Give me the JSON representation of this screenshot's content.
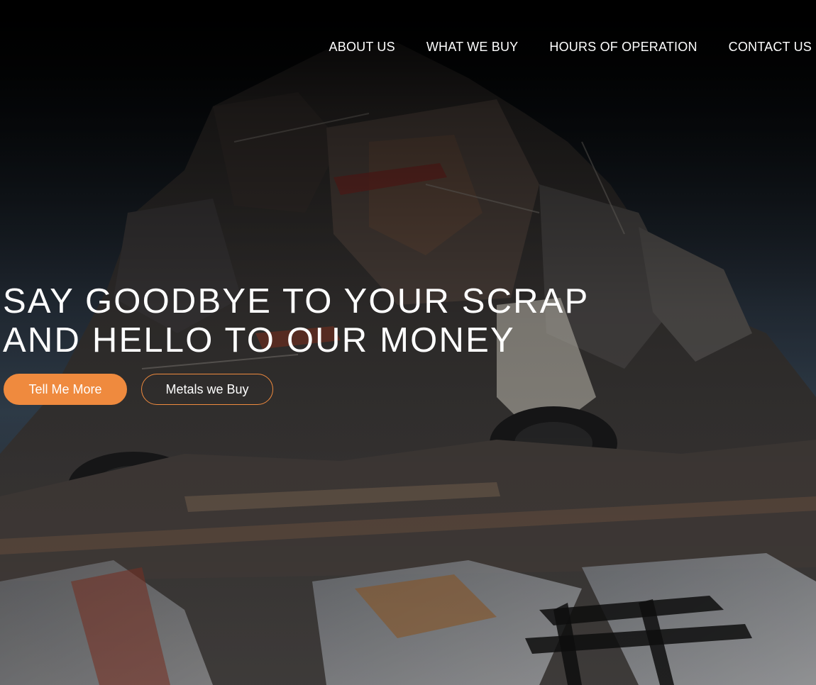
{
  "nav": {
    "items": [
      {
        "label": "ABOUT US"
      },
      {
        "label": "WHAT WE BUY"
      },
      {
        "label": "HOURS OF OPERATION"
      },
      {
        "label": "CONTACT US"
      }
    ]
  },
  "hero": {
    "headline_line1": "SAY GOODBYE TO YOUR SCRAP",
    "headline_line2": "AND HELLO TO OUR MONEY",
    "primary_button": "Tell Me More",
    "secondary_button": "Metals we Buy",
    "background": "junkyard-scrap-pile-photo"
  },
  "colors": {
    "accent": "#ef8a3e",
    "text": "#ffffff",
    "background": "#0b0b0d"
  }
}
